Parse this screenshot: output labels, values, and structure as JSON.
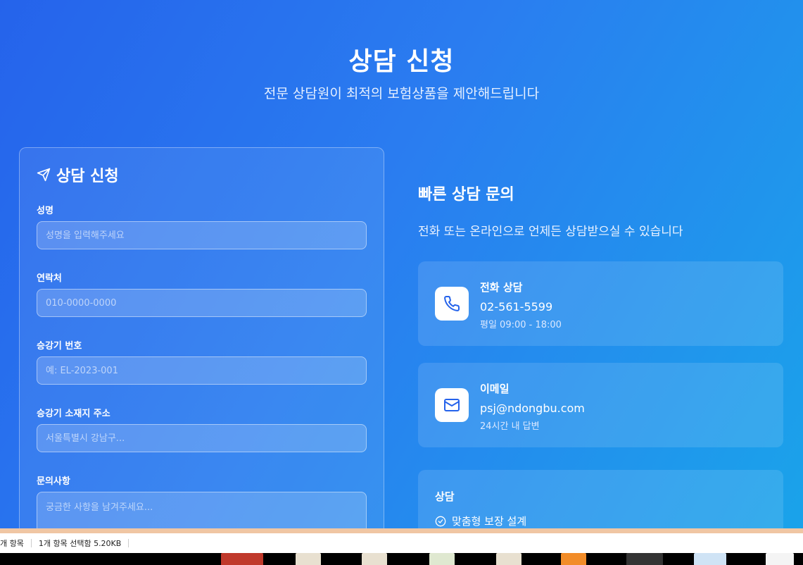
{
  "hero": {
    "title": "상담 신청",
    "subtitle": "전문 상담원이 최적의 보험상품을 제안해드립니다"
  },
  "form": {
    "title": "상담 신청",
    "icon": "send-icon",
    "fields": [
      {
        "label": "성명",
        "placeholder": "성명을 입력해주세요"
      },
      {
        "label": "연락처",
        "placeholder": "010-0000-0000"
      },
      {
        "label": "승강기 번호",
        "placeholder": "예: EL-2023-001"
      },
      {
        "label": "승강기 소재지 주소",
        "placeholder": "서울특별시 강남구..."
      },
      {
        "label": "문의사항",
        "placeholder": "궁금한 사항을 남겨주세요..."
      }
    ]
  },
  "info": {
    "title": "빠른 상담 문의",
    "description": "전화 또는 온라인으로 언제든 상담받으실 수 있습니다",
    "cards": [
      {
        "icon": "phone-icon",
        "title": "전화 상담",
        "main": "02-561-5599",
        "sub": "평일 09:00 - 18:00"
      },
      {
        "icon": "mail-icon",
        "title": "이메일",
        "main": "psj@ndongbu.com",
        "sub": "24시간 내 답변"
      }
    ],
    "consult": {
      "title": "상담",
      "items": [
        "맞춤형 보장 설계"
      ]
    }
  },
  "status_bar": {
    "item_count": "개 항목",
    "selection": "1개 항목 선택함 5.20KB"
  },
  "colors": {
    "gradient_start": "#2563eb",
    "gradient_end": "#1aa3ea",
    "icon_accent": "#2563eb"
  }
}
